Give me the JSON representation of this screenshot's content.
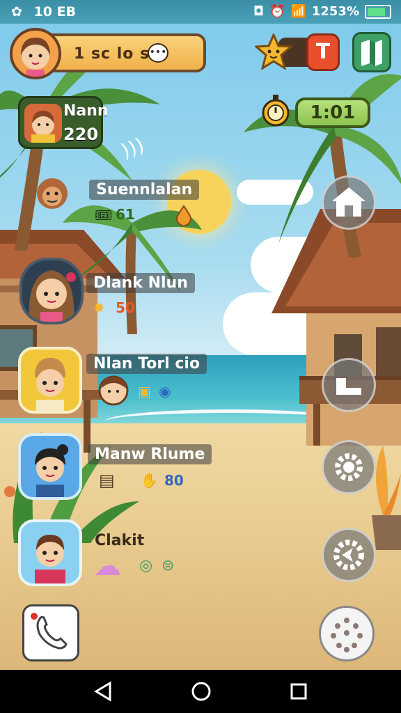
{
  "status_bar": {
    "time": "10 EB",
    "status_text": "1253%"
  },
  "top_bar": {
    "player_text": "1 sc lo s",
    "timer": "1:01"
  },
  "badges": {
    "t_label": "T"
  },
  "level_card": {
    "name": "Nann",
    "value": "220"
  },
  "friends": [
    {
      "name": "Suennlalan",
      "stat": "61"
    },
    {
      "name": "Dlank Nlun",
      "stat": "50"
    },
    {
      "name": "Nlan Torl cio"
    },
    {
      "name": "Manw Rlume",
      "stat": "80"
    },
    {
      "name": "Clakit"
    }
  ],
  "colors": {
    "accent_orange": "#f0b14b",
    "accent_green": "#8cc44e",
    "sky": "#7cc9ea"
  },
  "battery_level": 0.9
}
